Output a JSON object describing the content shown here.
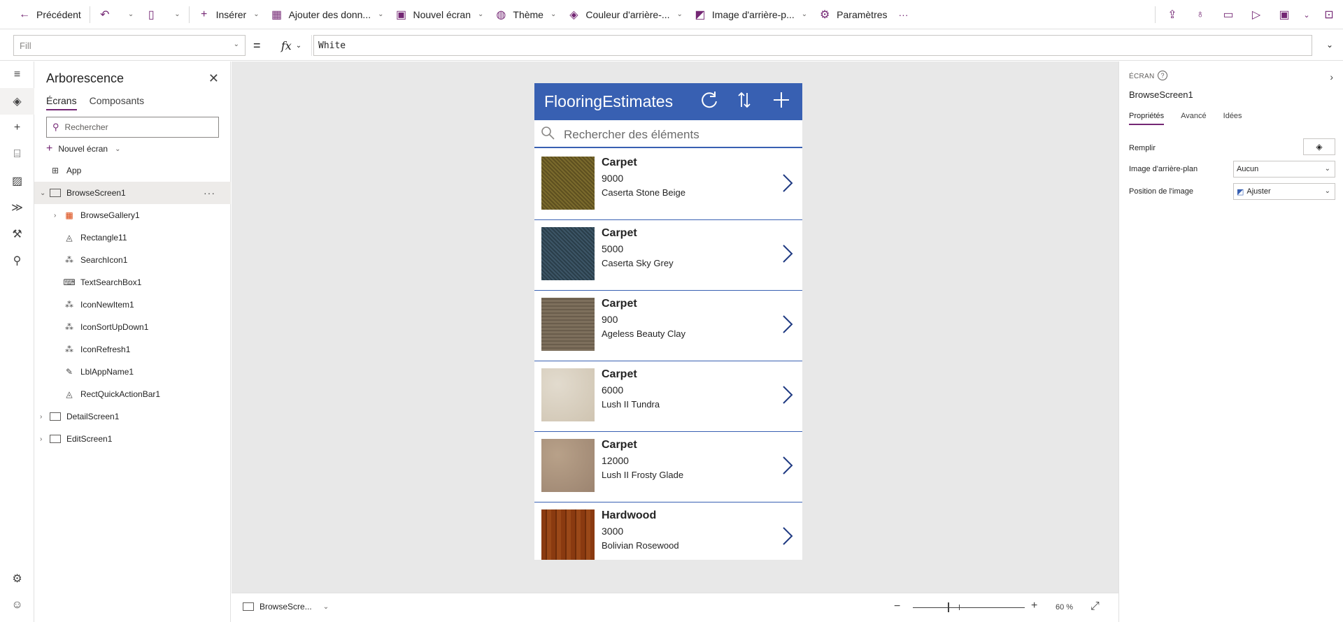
{
  "toolbar": {
    "back_label": "Précédent",
    "insert_label": "Insérer",
    "add_data_label": "Ajouter des donn...",
    "new_screen_label": "Nouvel écran",
    "theme_label": "Thème",
    "background_color_label": "Couleur d'arrière-...",
    "background_image_label": "Image d'arrière-p...",
    "settings_label": "Paramètres",
    "more_label": "···"
  },
  "formula": {
    "property": "Fill",
    "equals": "=",
    "fx": "fx",
    "value": "White"
  },
  "tree": {
    "title": "Arborescence",
    "tabs": [
      "Écrans",
      "Composants"
    ],
    "search_placeholder": "Rechercher",
    "new_screen_label": "Nouvel écran",
    "items": [
      {
        "label": "App"
      },
      {
        "label": "BrowseScreen1"
      },
      {
        "label": "BrowseGallery1"
      },
      {
        "label": "Rectangle11"
      },
      {
        "label": "SearchIcon1"
      },
      {
        "label": "TextSearchBox1"
      },
      {
        "label": "IconNewItem1"
      },
      {
        "label": "IconSortUpDown1"
      },
      {
        "label": "IconRefresh1"
      },
      {
        "label": "LblAppName1"
      },
      {
        "label": "RectQuickActionBar1"
      },
      {
        "label": "DetailScreen1"
      },
      {
        "label": "EditScreen1"
      }
    ]
  },
  "app": {
    "title": "FlooringEstimates",
    "search_placeholder": "Rechercher des éléments",
    "gallery": [
      {
        "category": "Carpet",
        "price": "9000",
        "name": "Caserta Stone Beige",
        "swatch": "#7a6a2c"
      },
      {
        "category": "Carpet",
        "price": "5000",
        "name": "Caserta Sky Grey",
        "swatch": "#3c5566"
      },
      {
        "category": "Carpet",
        "price": "900",
        "name": "Ageless Beauty Clay",
        "swatch": "#7d6f5c"
      },
      {
        "category": "Carpet",
        "price": "6000",
        "name": "Lush II Tundra",
        "swatch": "#d4cbbc"
      },
      {
        "category": "Carpet",
        "price": "12000",
        "name": "Lush II Frosty Glade",
        "swatch": "#a89078"
      },
      {
        "category": "Hardwood",
        "price": "3000",
        "name": "Bolivian Rosewood",
        "swatch": "#8a3a10"
      }
    ]
  },
  "status": {
    "screen_label": "BrowseScre...",
    "zoom": "60 %",
    "zoom_minus": "−",
    "zoom_plus": "+"
  },
  "props": {
    "kind": "ÉCRAN",
    "name": "BrowseScreen1",
    "tabs": [
      "Propriétés",
      "Avancé",
      "Idées"
    ],
    "fill_label": "Remplir",
    "bg_image_label": "Image d'arrière-plan",
    "bg_image_value": "Aucun",
    "image_position_label": "Position de l'image",
    "image_position_value": "Ajuster"
  },
  "colors": {
    "accent": "#742774",
    "app_header": "#3860b2"
  }
}
